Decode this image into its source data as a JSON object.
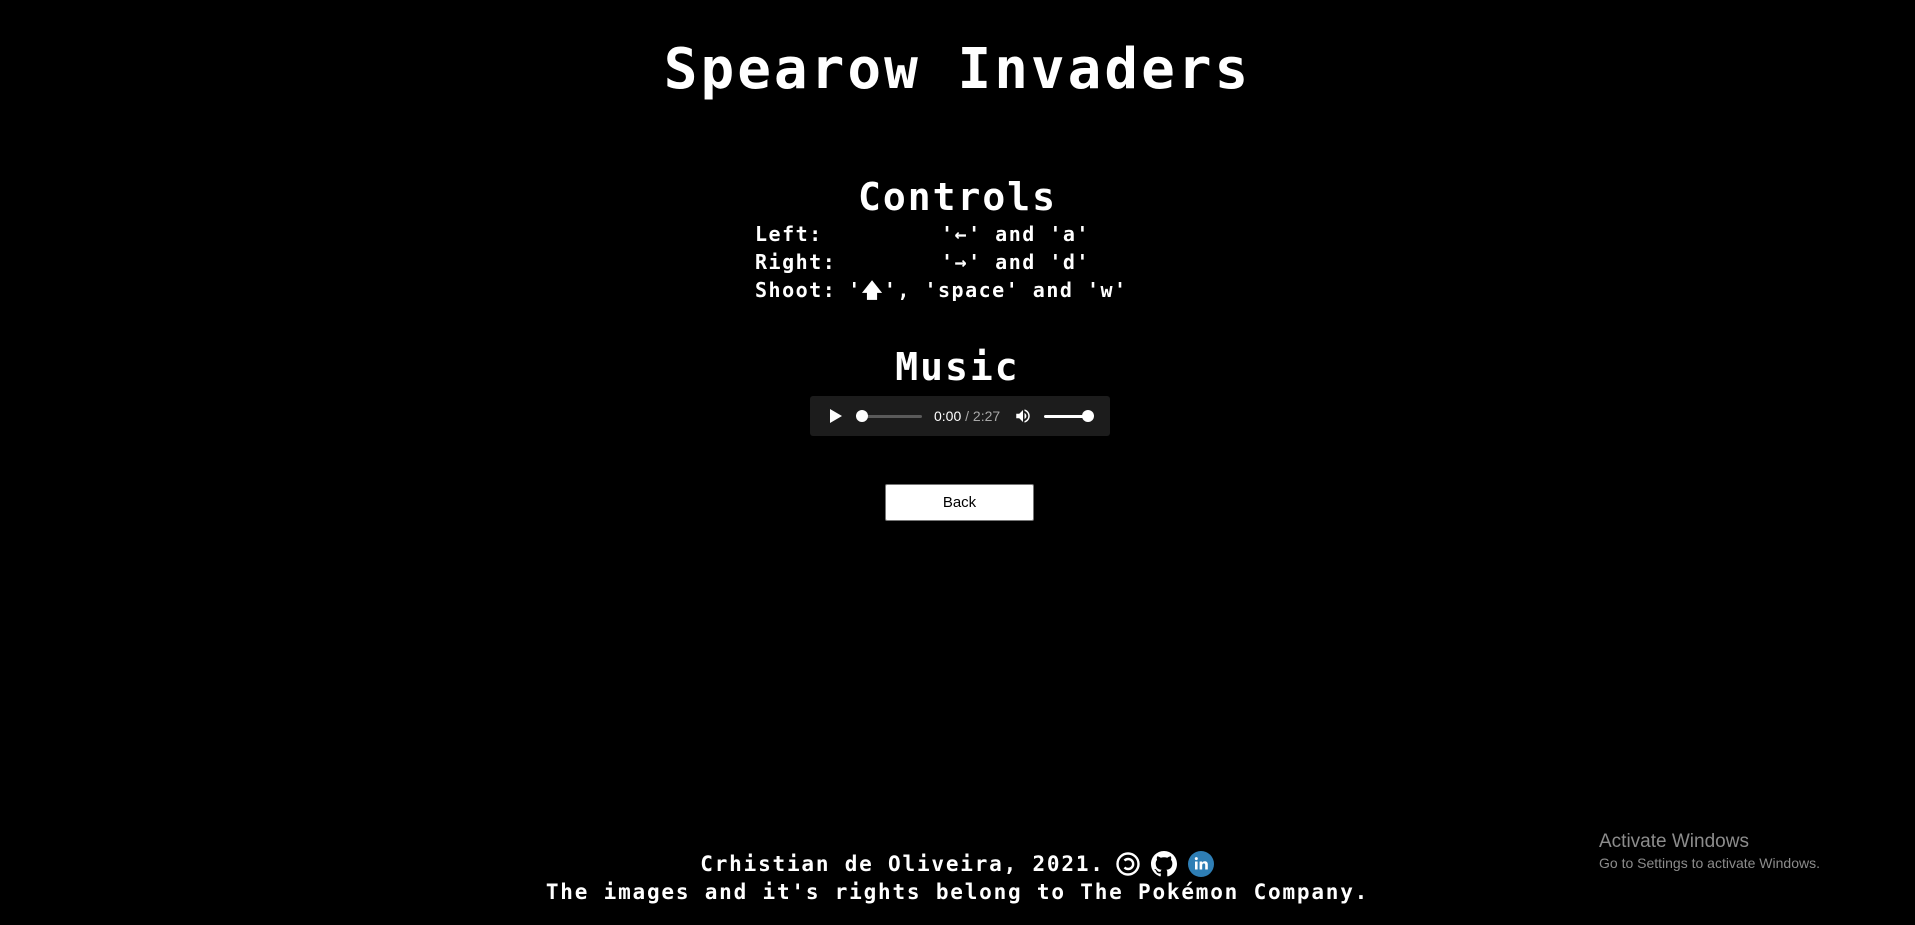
{
  "page": {
    "title": "Spearow Invaders"
  },
  "controls": {
    "heading": "Controls",
    "rows": [
      {
        "label": "Left:",
        "keys": "'←' and 'a'"
      },
      {
        "label": "Right:",
        "keys": "'→' and 'd'"
      },
      {
        "label": "Shoot:",
        "keys": "'🡅', 'space' and 'w'"
      }
    ]
  },
  "music": {
    "heading": "Music",
    "player": {
      "current_time": "0:00",
      "separator": " / ",
      "duration": "2:27",
      "progress": 0,
      "volume": 1
    }
  },
  "back_button": {
    "label": "Back"
  },
  "footer": {
    "credit": "Crhistian de Oliveira, 2021.",
    "rights": "The images and it's rights belong to The Pokémon Company.",
    "icons": [
      "copyleft-icon",
      "github-icon",
      "linkedin-icon"
    ],
    "linkedin_color": "#2e7eb5"
  },
  "os_overlay": {
    "title": "Activate Windows",
    "subtitle": "Go to Settings to activate Windows."
  }
}
